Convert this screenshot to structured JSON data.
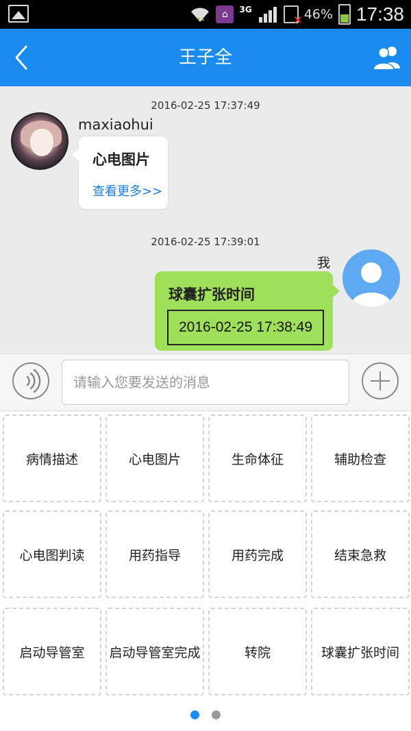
{
  "status_bar": {
    "signal_type": "3G",
    "battery_percent": "46%",
    "battery_level": 0.46,
    "time": "17:38"
  },
  "header": {
    "title": "王子全",
    "back_icon": "chevron-left-icon",
    "contacts_icon": "contacts-icon",
    "background_color": "#1a8cf0"
  },
  "chat": {
    "messages": [
      {
        "timestamp": "2016-02-25 17:37:49",
        "sender": "maxiaohui",
        "direction": "incoming",
        "title": "心电图片",
        "link_text": "查看更多>>"
      },
      {
        "timestamp": "2016-02-25 17:39:01",
        "sender": "我",
        "direction": "outgoing",
        "title": "球囊扩张时间",
        "value": "2016-02-25 17:38:49"
      }
    ]
  },
  "input_bar": {
    "voice_icon": "voice-icon",
    "placeholder": "请输入您要发送的消息",
    "plus_icon": "plus-icon"
  },
  "actions": [
    "病情描述",
    "心电图片",
    "生命体征",
    "辅助检查",
    "心电图判读",
    "用药指导",
    "用药完成",
    "结束急救",
    "启动导管室",
    "启动导管室完成",
    "转院",
    "球囊扩张时间"
  ],
  "pager": {
    "page_count": 2,
    "current_page": 1
  }
}
